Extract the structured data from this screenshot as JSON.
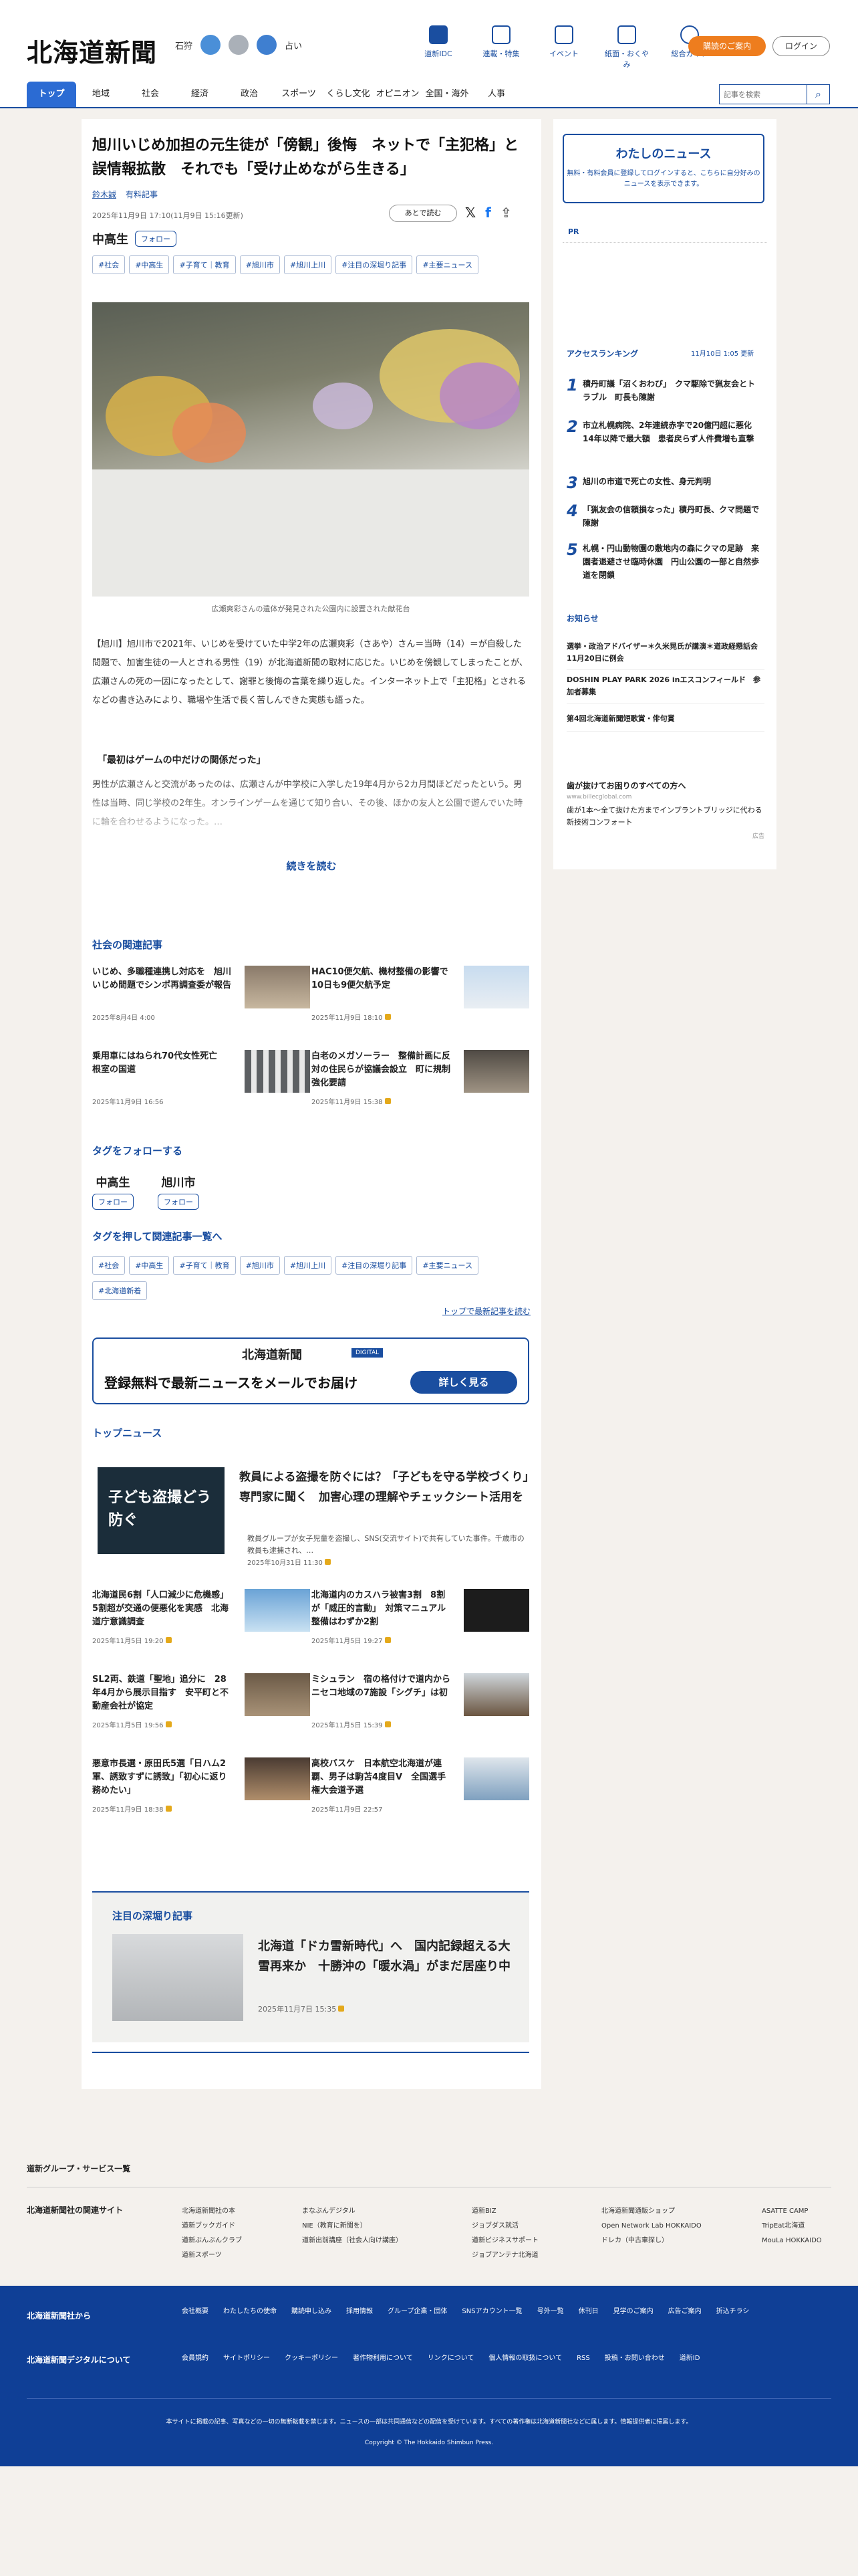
{
  "header": {
    "logo": "北海道新聞",
    "weather": {
      "city": "石狩",
      "label": "占い"
    },
    "icons": [
      {
        "label": "道新IDC",
        "icon": "newspaper-icon"
      },
      {
        "label": "連載・特集",
        "icon": "flag-icon"
      },
      {
        "label": "イベント",
        "icon": "calendar-icon"
      },
      {
        "label": "紙面・おくやみ",
        "icon": "paper-icon"
      },
      {
        "label": "総合ガイド",
        "icon": "help-icon"
      }
    ],
    "guide_button": "購読のご案内",
    "login_button": "ログイン"
  },
  "nav": {
    "items": [
      "トップ",
      "地域",
      "社会",
      "経済",
      "政治",
      "スポーツ",
      "くらし文化",
      "オピニオン",
      "全国・海外",
      "人事"
    ],
    "search_placeholder": "記事を検索"
  },
  "article": {
    "title": "旭川いじめ加担の元生徒が「傍観」後悔　ネットで「主犯格」と誤情報拡散　それでも「受け止めながら生きる」",
    "author": "鈴木誠",
    "badge": "有料記事",
    "date": "2025年11月9日 17:10(11月9日 15:16更新)",
    "read_later": "あとで読む",
    "primary_tag": "中高生",
    "follow": "フォロー",
    "tags": [
      "#社会",
      "#中高生",
      "#子育て｜教育",
      "#旭川市",
      "#旭川上川",
      "#注目の深堀り記事",
      "#主要ニュース"
    ],
    "photo_caption": "広瀬爽彩さんの遺体が発見された公園内に設置された献花台",
    "paragraph1": "【旭川】旭川市で2021年、いじめを受けていた中学2年の広瀬爽彩（さあや）さん＝当時（14）＝が自殺した問題で、加害生徒の一人とされる男性（19）が北海道新聞の取材に応じた。いじめを傍観してしまったことが、広瀬さんの死の一因になったとして、謝罪と後悔の言葉を繰り返した。インターネット上で「主犯格」とされるなどの書き込みにより、職場や生活で長く苦しんできた実態も語った。",
    "subheading": "「最初はゲームの中だけの関係だった」",
    "paragraph2": "男性が広瀬さんと交流があったのは、広瀬さんが中学校に入学した19年4月から2カ月間ほどだったという。男性は当時、同じ学校の2年生。オンラインゲームを通じて知り合い、その後、ほかの友人と公園で遊んでいた時に輪を合わせるようになった。…",
    "read_more": "続きを読む"
  },
  "related": {
    "title": "社会の関連記事",
    "items": [
      {
        "title": "いじめ、多職種連携し対応を　旭川いじめ問題でシンポ再調査委が報告",
        "date": "2025年8月4日 4:00"
      },
      {
        "title": "HAC10便欠航、機材整備の影響で　10日も9便欠航予定",
        "date": "2025年11月9日 18:10"
      },
      {
        "title": "乗用車にはねられ70代女性死亡　根室の国道",
        "date": "2025年11月9日 16:56"
      },
      {
        "title": "白老のメガソーラー　整備計画に反対の住民らが協議会設立　町に規制強化要請",
        "date": "2025年11月9日 15:38"
      }
    ]
  },
  "follow_tags": {
    "title": "タグをフォローする",
    "items": [
      {
        "name": "中高生",
        "button": "フォロー"
      },
      {
        "name": "旭川市",
        "button": "フォロー"
      }
    ]
  },
  "tag_list": {
    "title": "タグを押して関連記事一覧へ",
    "items": [
      "#社会",
      "#中高生",
      "#子育て｜教育",
      "#旭川市",
      "#旭川上川",
      "#注目の深堀り記事",
      "#主要ニュース",
      "#北海道新着"
    ],
    "top_link": "トップで最新記事を読む"
  },
  "promo": {
    "logo": "北海道新聞",
    "badge": "DIGITAL",
    "text": "登録無料で最新ニュースをメールでお届け",
    "button": "詳しく見る"
  },
  "top_news": {
    "title": "トップニュース",
    "hero": {
      "overlay": "子ども盗撮どう防ぐ",
      "title": "教員による盗撮を防ぐには？「子どもを守る学校づくり」専門家に聞く　加害心理の理解やチェックシート活用を",
      "summary": "教員グループが女子児童を盗撮し、SNS(交流サイト)で共有していた事件。千歳市の教員も逮捕され、…",
      "date": "2025年10月31日 11:30"
    },
    "items": [
      {
        "title": "北海道民6割「人口減少に危機感」　5割超が交通の便悪化を実感　北海道庁意識調査",
        "date": "2025年11月5日 19:20"
      },
      {
        "title": "北海道内のカスハラ被害3割　8割が「威圧的言動」　対策マニュアル整備はわずか2割",
        "date": "2025年11月5日 19:27"
      },
      {
        "title": "SL2両、鉄道「聖地」追分に　28年4月から展示目指す　安平町と不動産会社が協定",
        "date": "2025年11月5日 19:56"
      },
      {
        "title": "ミシュラン　宿の格付けで道内から ニセコ地域の7施設「シグチ」は初",
        "date": "2025年11月5日 15:39"
      },
      {
        "title": "悪意市長選・原田氏5選「日ハム2軍、誘致すずに誘致」「初心に返り務めたい」",
        "date": "2025年11月9日 18:38"
      },
      {
        "title": "高校バスケ　日本航空北海道が連覇、男子は駒苫4度目V　全国選手権大会道予選",
        "date": "2025年11月9日 22:57"
      }
    ]
  },
  "featured": {
    "title": "注目の深堀り記事",
    "headline": "北海道「ドカ雪新時代」へ　国内記録超える大雪再来か　十勝沖の「暖水渦」がまだ居座り中",
    "date": "2025年11月7日 15:35"
  },
  "sidebar": {
    "mynews_title": "わたしのニュース",
    "mynews_desc": "無料・有料会員に登録してログインすると、こちらに自分好みのニュースを表示できます。",
    "pr_label": "PR",
    "ranking_title": "アクセスランキング",
    "ranking_update": "11月10日 1:05 更新",
    "ranking": [
      {
        "num": "1",
        "title": "積丹町議「沼くおわび」　クマ駆除で猟友会とトラブル　町長も陳謝"
      },
      {
        "num": "2",
        "title": "市立札幌病院、2年連続赤字で20億円超に悪化　14年以降で最大額　患者戻らず人件費増も直撃"
      },
      {
        "num": "3",
        "title": "旭川の市道で死亡の女性、身元判明"
      },
      {
        "num": "4",
        "title": "「猟友会の信頼損なった」積丹町長、クマ問題で陳謝"
      },
      {
        "num": "5",
        "title": "札幌・円山動物園の敷地内の森にクマの足跡　来園者退避させ臨時休園　円山公園の一部と自然歩道を閉鎖"
      }
    ],
    "notice_title": "お知らせ",
    "notices": [
      "選挙・政治アドバイザー＊久米晃氏が講演＊道政経懇話会11月20日に例会",
      "DOSHIN PLAY PARK 2026 inエスコンフィールド　参加者募集",
      "第4回北海道新聞短歌賞・俳句賞"
    ],
    "ad": {
      "head": "歯が抜けてお困りのすべての方へ",
      "url": "www.billecglobal.com",
      "desc": "歯が1本〜全て抜けた方までインプラントブリッジに代わる新技術コンフォート",
      "more": "広告"
    }
  },
  "footer": {
    "group_title": "道新グループ・サービス一覧",
    "related_sites_title": "北海道新聞社の関連サイト",
    "sites_col1": [
      "北海道新聞社の本",
      "道新ブックガイド",
      "道新ぶんぶんクラブ",
      "道新スポーツ"
    ],
    "sites_col2": [
      "まなぶんデジタル",
      "NIE（教育に新聞を）",
      "道新出前講座（社会人向け講座）"
    ],
    "sites_col3": [
      "道新BIZ",
      "ジョブダス就活",
      "道新ビジネスサポート",
      "ジョブアンテナ北海道"
    ],
    "sites_col4": [
      "北海道新聞通販ショップ",
      "Open Network Lab HOKKAIDO",
      "ドレカ（中古車探し）"
    ],
    "sites_col5": [
      "ASATTE CAMP",
      "TripEat北海道",
      "MouLa HOKKAIDO"
    ],
    "company_title": "北海道新聞社から",
    "company_links": [
      "会社概要",
      "わたしたちの使命",
      "購読申し込み",
      "採用情報",
      "グループ企業・団体",
      "SNSアカウント一覧",
      "号外一覧",
      "休刊日",
      "見学のご案内",
      "広告ご案内",
      "折込チラシ"
    ],
    "digital_title": "北海道新聞デジタルについて",
    "digital_links": [
      "会員規約",
      "サイトポリシー",
      "クッキーポリシー",
      "著作物利用について",
      "リンクについて",
      "個人情報の取扱について",
      "RSS",
      "投稿・お問い合わせ",
      "道新ID"
    ],
    "note": "本サイトに掲載の記事、写真などの一切の無断転載を禁じます。ニュースの一部は共同通信などの配信を受けています。すべての著作権は北海道新聞社などに属します。情報提供者に帰属します。",
    "copyright": "Copyright © The Hokkaido Shimbun Press."
  }
}
